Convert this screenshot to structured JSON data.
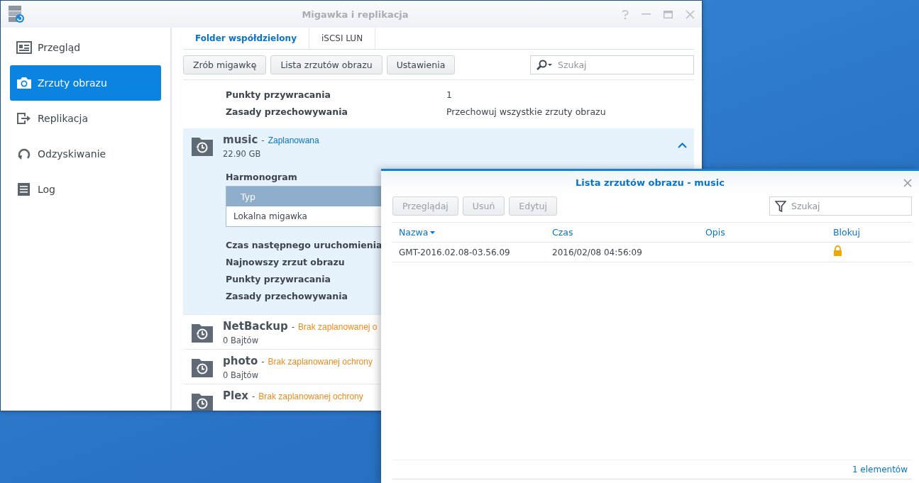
{
  "window": {
    "title": "Migawka i replikacja"
  },
  "sidebar": {
    "items": [
      {
        "label": "Przegląd",
        "selected": false
      },
      {
        "label": "Zrzuty obrazu",
        "selected": true
      },
      {
        "label": "Replikacja",
        "selected": false
      },
      {
        "label": "Odzyskiwanie",
        "selected": false
      },
      {
        "label": "Log",
        "selected": false
      }
    ]
  },
  "tabs": [
    {
      "label": "Folder współdzielony",
      "selected": true
    },
    {
      "label": "iSCSI LUN",
      "selected": false
    }
  ],
  "toolbar": {
    "buttons": [
      "Zrób migawkę",
      "Lista zrzutów obrazu",
      "Ustawienia"
    ],
    "search": {
      "placeholder": "Szukaj"
    }
  },
  "details_top": [
    {
      "label": "Punkty przywracania",
      "value": "1"
    },
    {
      "label": "Zasady przechowywania",
      "value": "Przechowuj wszystkie zrzuty obrazu"
    }
  ],
  "folders": [
    {
      "name": "music",
      "dash": "-",
      "status": "Zaplanowana",
      "scheduled": true,
      "size": "22.90 GB",
      "expanded": true,
      "schedule_title": "Harmonogram",
      "schedule_column": "Typ",
      "schedule_row": "Lokalna migawka",
      "details": [
        "Czas następnego uruchomienia",
        "Najnowszy zrzut obrazu",
        "Punkty przywracania",
        "Zasady przechowywania"
      ]
    },
    {
      "name": "NetBackup",
      "dash": "-",
      "status": "Brak zaplanowanej o",
      "scheduled": false,
      "size": "0 Bajtów",
      "expanded": false
    },
    {
      "name": "photo",
      "dash": "-",
      "status": "Brak zaplanowanej ochrony",
      "scheduled": false,
      "size": "0 Bajtów",
      "expanded": false
    },
    {
      "name": "Plex",
      "dash": "-",
      "status": "Brak zaplanowanej ochrony",
      "scheduled": false,
      "expanded": false
    }
  ],
  "dialog": {
    "title": "Lista zrzutów obrazu - music",
    "buttons": [
      {
        "label": "Przeglądaj",
        "disabled": true
      },
      {
        "label": "Usuń",
        "disabled": true
      },
      {
        "label": "Edytuj",
        "disabled": true
      }
    ],
    "search": {
      "placeholder": "Szukaj"
    },
    "columns": [
      "Nazwa",
      "Czas",
      "Opis",
      "Blokuj"
    ],
    "rows": [
      {
        "name": "GMT-2016.02.08-03.56.09",
        "time": "2016/02/08 04:56:09",
        "locked": true
      }
    ],
    "footer": "1 elementów"
  }
}
